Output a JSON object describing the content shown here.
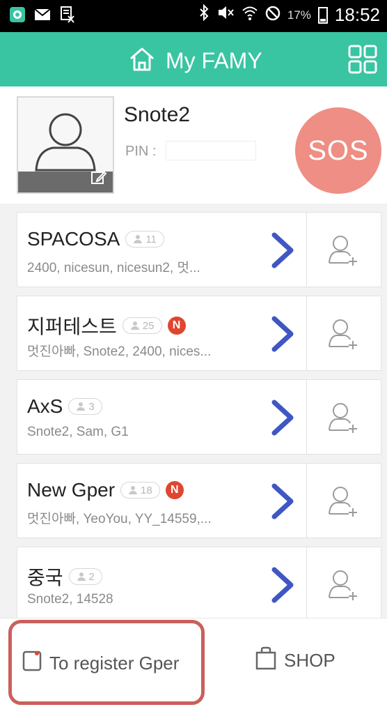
{
  "status_bar": {
    "battery_percent": "17%",
    "time": "18:52"
  },
  "header": {
    "title": "My FAMY"
  },
  "profile": {
    "name": "Snote2",
    "pin_label": "PIN :",
    "sos_label": "SOS"
  },
  "groups": [
    {
      "name": "SPACOSA",
      "count": "11",
      "is_new": false,
      "members": "2400, nicesun, nicesun2, 멋..."
    },
    {
      "name": "지퍼테스트",
      "count": "25",
      "is_new": true,
      "members": "멋진아빠, Snote2, 2400, nices..."
    },
    {
      "name": "AxS",
      "count": "3",
      "is_new": false,
      "members": "Snote2, Sam, G1"
    },
    {
      "name": "New Gper",
      "count": "18",
      "is_new": true,
      "members": "멋진아빠, YeoYou, YY_14559,..."
    },
    {
      "name": "중국",
      "count": "2",
      "is_new": false,
      "members": "Snote2, 14528"
    }
  ],
  "new_badge_label": "N",
  "bottom": {
    "register_label": "To register Gper",
    "shop_label": "SHOP"
  },
  "colors": {
    "header": "#39c4a2",
    "sos": "#ef8e84",
    "chevron": "#3f56c4",
    "new_badge": "#e0462f",
    "highlight": "#c9605c"
  }
}
